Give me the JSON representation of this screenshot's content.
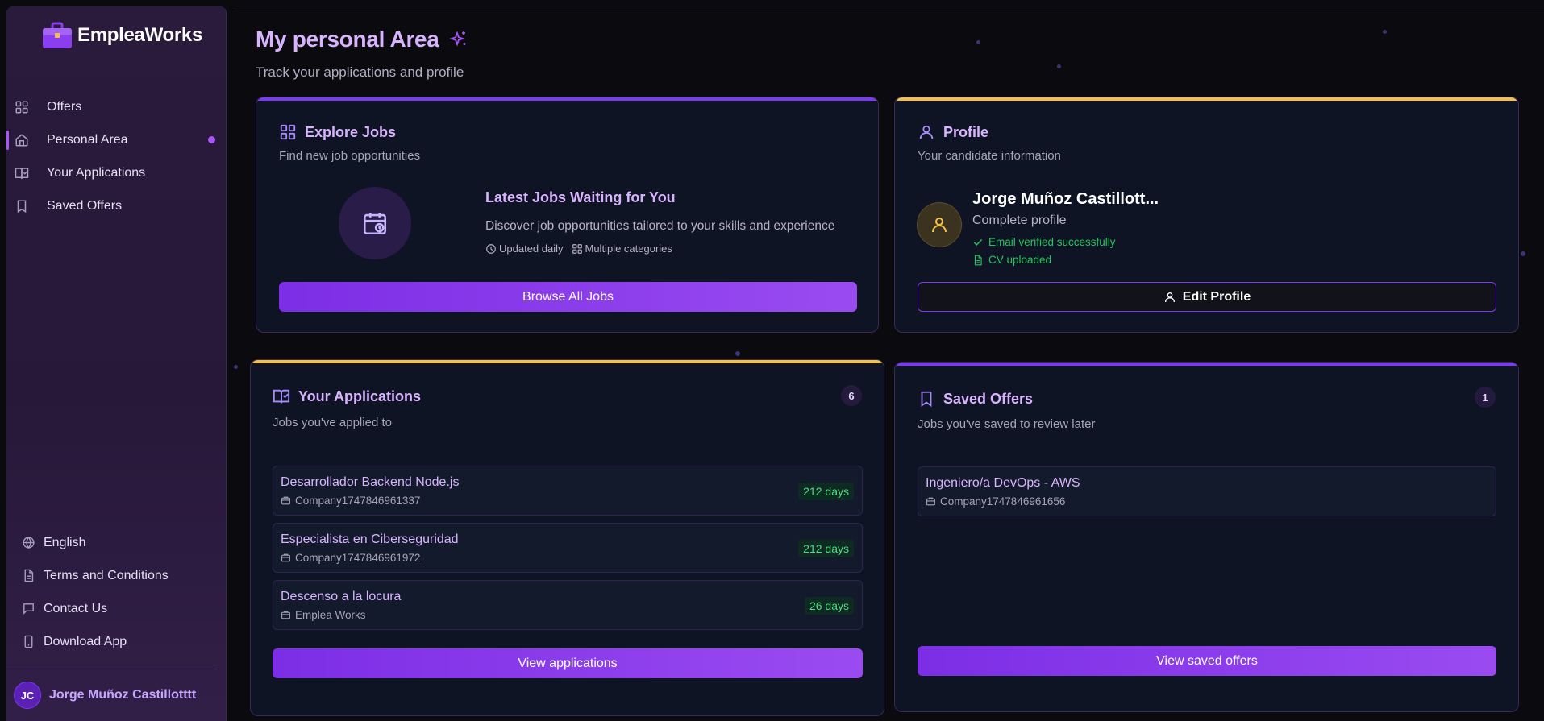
{
  "brand": {
    "name": "EmpleaWorks"
  },
  "sidebar": {
    "items": [
      {
        "label": "Offers",
        "icon": "grid-icon"
      },
      {
        "label": "Personal Area",
        "icon": "home-icon"
      },
      {
        "label": "Your Applications",
        "icon": "book-check-icon"
      },
      {
        "label": "Saved Offers",
        "icon": "bookmark-icon"
      }
    ],
    "bottom": [
      {
        "label": "English",
        "icon": "globe-icon"
      },
      {
        "label": "Terms and Conditions",
        "icon": "document-icon"
      },
      {
        "label": "Contact Us",
        "icon": "message-icon"
      },
      {
        "label": "Download App",
        "icon": "smartphone-icon"
      }
    ],
    "user": {
      "initials": "JC",
      "name": "Jorge Muñoz Castillotttt"
    }
  },
  "header": {
    "title": "My personal Area",
    "subtitle": "Track your applications and profile"
  },
  "explore": {
    "title": "Explore Jobs",
    "subtitle": "Find new job opportunities",
    "latest_title": "Latest Jobs Waiting for You",
    "latest_desc": "Discover job opportunities tailored to your skills and experience",
    "meta_updated": "Updated daily",
    "meta_categories": "Multiple categories",
    "button": "Browse All Jobs"
  },
  "profile": {
    "title": "Profile",
    "subtitle": "Your candidate information",
    "name": "Jorge Muñoz Castillott...",
    "status": "Complete profile",
    "email_status": "Email verified successfully",
    "cv_status": "CV uploaded",
    "button": "Edit Profile"
  },
  "applications": {
    "title": "Your Applications",
    "subtitle": "Jobs you've applied to",
    "count": "6",
    "items": [
      {
        "title": "Desarrollador Backend Node.js",
        "company": "Company1747846961337",
        "days": "212 days"
      },
      {
        "title": "Especialista en Ciberseguridad",
        "company": "Company1747846961972",
        "days": "212 days"
      },
      {
        "title": "Descenso a la locura",
        "company": "Emplea Works",
        "days": "26 days"
      }
    ],
    "button": "View applications"
  },
  "saved": {
    "title": "Saved Offers",
    "subtitle": "Jobs you've saved to review later",
    "count": "1",
    "items": [
      {
        "title": "Ingeniero/a DevOps - AWS",
        "company": "Company1747846961656"
      }
    ],
    "button": "View saved offers"
  },
  "colors": {
    "accent": "#a855f7",
    "explore_bar": "#7c3aed",
    "profile_bar": "#f5c04a",
    "applications_bar": "#f5c04a",
    "saved_bar": "#7c3aed",
    "success": "#22c55e"
  }
}
